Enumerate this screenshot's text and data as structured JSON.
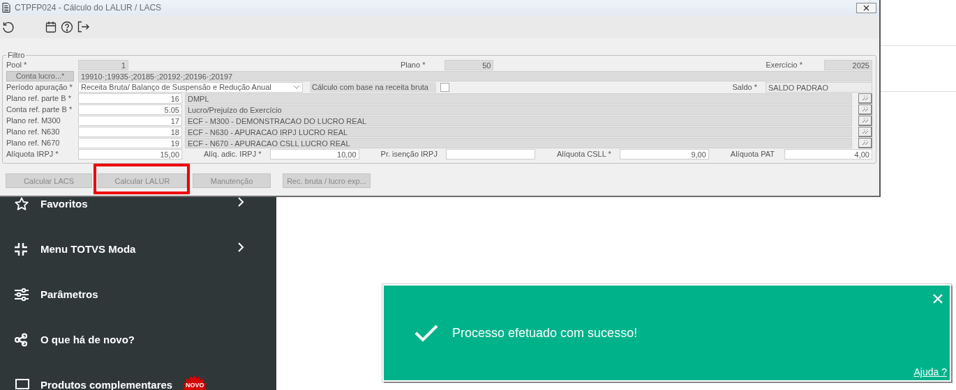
{
  "window": {
    "title": "CTPFP024 - Cálculo do LALUR / LACS"
  },
  "filter": {
    "legend": "Filtro",
    "pool": {
      "label": "Pool *",
      "value": "1"
    },
    "plano": {
      "label": "Plano *",
      "value": "50"
    },
    "exercicio": {
      "label": "Exercício *",
      "value": "2025"
    },
    "conta_lucro": {
      "button": "Conta lucro...*",
      "value": "19910·;19935·;20185·;20192·;20196·;20197"
    },
    "periodo": {
      "label": "Período apuração *",
      "value": "Receita Bruta/ Balanço de Suspensão e Redução Anual"
    },
    "receita_bruta": {
      "label": "Cálculo com base na receita bruta",
      "checked": false
    },
    "saldo": {
      "label": "Saldo *",
      "value": "SALDO PADRAO"
    },
    "ref_rows": [
      {
        "label": "Plano ref. parte B *",
        "code": "16",
        "description": "DMPL"
      },
      {
        "label": "Conta ref. parte B *",
        "code": "5.05",
        "description": "Lucro/Prejuízo do Exercício"
      },
      {
        "label": "Plano ref. M300",
        "code": "17",
        "description": "ECF - M300 - DEMONSTRACAO DO LUCRO REAL"
      },
      {
        "label": "Plano ref. N630",
        "code": "18",
        "description": "ECF - N630 - APURACAO IRPJ LUCRO REAL"
      },
      {
        "label": "Plano ref. N670",
        "code": "19",
        "description": "ECF - N670 - APURACAO CSLL LUCRO REAL"
      }
    ],
    "rates": [
      {
        "label": "Alíquota IRPJ *",
        "value": "15,00"
      },
      {
        "label": "Alíq. adic. IRPJ *",
        "value": "10,00"
      },
      {
        "label": "Pr. isenção IRPJ"
      },
      {
        "label": "Alíquota CSLL *",
        "value": "9,00"
      },
      {
        "label": "Alíquota PAT",
        "value": "4,00"
      }
    ]
  },
  "buttons": [
    {
      "label": "Calcular LACS",
      "highlighted": false
    },
    {
      "label": "Calcular LALUR",
      "highlighted": true
    },
    {
      "label": "Manutenção",
      "highlighted": false
    },
    {
      "label": "Rec. bruta / lucro exp...",
      "highlighted": false
    }
  ],
  "sidebar": {
    "items": [
      {
        "label": "Favoritos",
        "has_submenu": true
      },
      {
        "label": "Menu TOTVS Moda",
        "has_submenu": true
      },
      {
        "label": "Parâmetros",
        "has_submenu": false
      },
      {
        "label": "O que há de novo?",
        "has_submenu": false
      },
      {
        "label": "Produtos complementares",
        "has_submenu": false,
        "badge": "NOVO"
      }
    ]
  },
  "toast": {
    "message": "Processo efetuado com sucesso!",
    "help_link": "Ajuda ?"
  }
}
